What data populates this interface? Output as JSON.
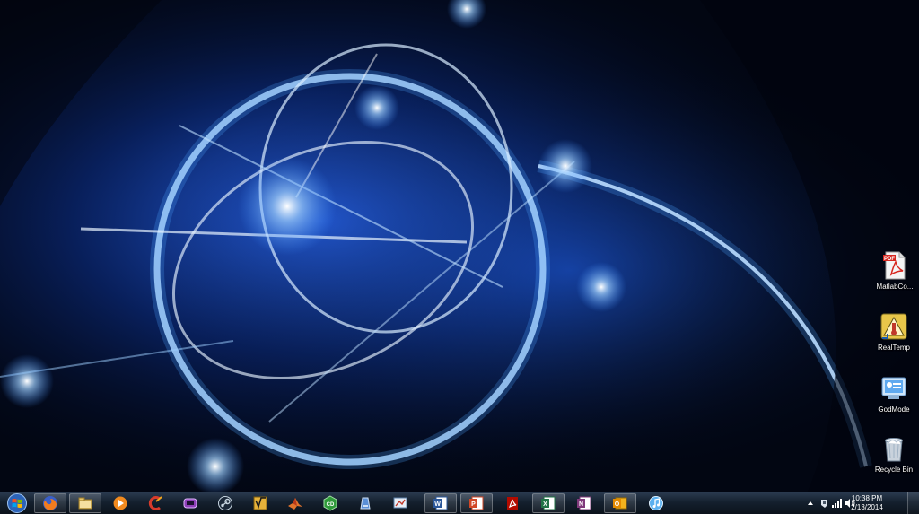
{
  "colors": {
    "wallpaper_base": "#020612",
    "wallpaper_glow": "#3b8cff",
    "taskbar": "#14202e"
  },
  "desktop": {
    "icons": [
      {
        "label": "MatlabCo...",
        "icon": "pdf-file-icon"
      },
      {
        "label": "RealTemp",
        "icon": "realtemp-icon"
      },
      {
        "label": "GodMode",
        "icon": "control-panel-icon"
      },
      {
        "label": "Recycle Bin",
        "icon": "recycle-bin-icon"
      }
    ]
  },
  "taskbar": {
    "start_icon": "windows-start-icon",
    "apps": [
      {
        "icon": "firefox-icon"
      },
      {
        "icon": "file-explorer-icon"
      },
      {
        "icon": "media-player-icon"
      },
      {
        "icon": "ccleaner-icon"
      },
      {
        "icon": "game-controller-icon"
      },
      {
        "icon": "steam-icon"
      },
      {
        "icon": "mathcad-icon"
      },
      {
        "icon": "matlab-icon"
      },
      {
        "icon": "cd-burner-icon"
      },
      {
        "icon": "drive-icon"
      },
      {
        "icon": "presentation-app-icon"
      },
      {
        "icon": "word-icon"
      },
      {
        "icon": "powerpoint-icon"
      },
      {
        "icon": "acrobat-icon"
      },
      {
        "icon": "excel-icon"
      },
      {
        "icon": "onenote-icon"
      },
      {
        "icon": "outlook-icon"
      },
      {
        "icon": "itunes-icon"
      }
    ],
    "tray": {
      "icons": [
        "show-hidden-icons-arrow-icon",
        "action-center-icon",
        "network-icon",
        "volume-icon"
      ],
      "time": "10:38 PM",
      "date": "2/13/2014"
    }
  }
}
